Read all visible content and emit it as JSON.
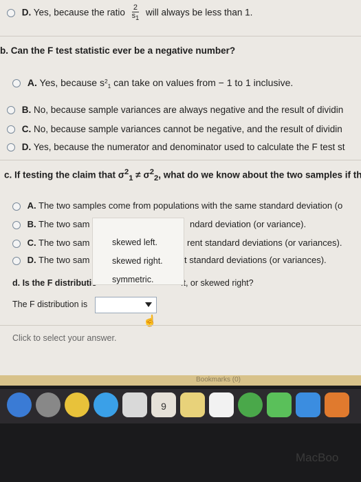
{
  "lines": {
    "d_top": {
      "letter": "D.",
      "pre": "Yes, because the ratio",
      "num": "2",
      "den": "s",
      "den_sub": "1",
      "post": "will always be less than 1."
    },
    "b_q": "b. Can the F test statistic ever be a negative number?",
    "a_opt": {
      "letter": "A.",
      "pre": "Yes, because s",
      "sub": "1",
      "sup": "2",
      "post": "can take on values from  − 1 to 1 inclusive."
    },
    "b_opt": {
      "letter": "B.",
      "text": "No, because sample variances are always negative and the result of dividin"
    },
    "c_opt": {
      "letter": "C.",
      "text": "No, because sample variances cannot be negative, and the result of dividin"
    },
    "d_opt": {
      "letter": "D.",
      "text": "Yes, because the numerator and denominator used to calculate the F test st"
    },
    "c_q": {
      "pre": "c. If testing the claim that σ",
      "mid": " ≠ σ",
      "post": ", what do we know about the two samples if the te",
      "sub1": "1",
      "sub2": "2",
      "sup": "2"
    },
    "c_a": {
      "letter": "A.",
      "text": "The two samples come from populations with the same standard deviation (o"
    },
    "c_b": {
      "letter": "B.",
      "pre": "The two sam",
      "post": "ndard deviation (or variance)."
    },
    "c_c": {
      "letter": "C.",
      "pre": "The two sam",
      "post": "rent standard deviations (or variances)."
    },
    "c_d": {
      "letter": "D.",
      "pre": "The two sam",
      "post": "t standard deviations (or variances)."
    },
    "d_q": {
      "pre": "d. Is the F distributio",
      "post": "ft, or skewed right?"
    },
    "f_dist": "The F distribution is",
    "click": "Click to select your answer."
  },
  "popup": {
    "options": [
      "skewed left.",
      "skewed right.",
      "symmetric."
    ]
  },
  "bookmarks": "Bookmarks (0)",
  "dock_date": "9",
  "brand": "MacBoo"
}
